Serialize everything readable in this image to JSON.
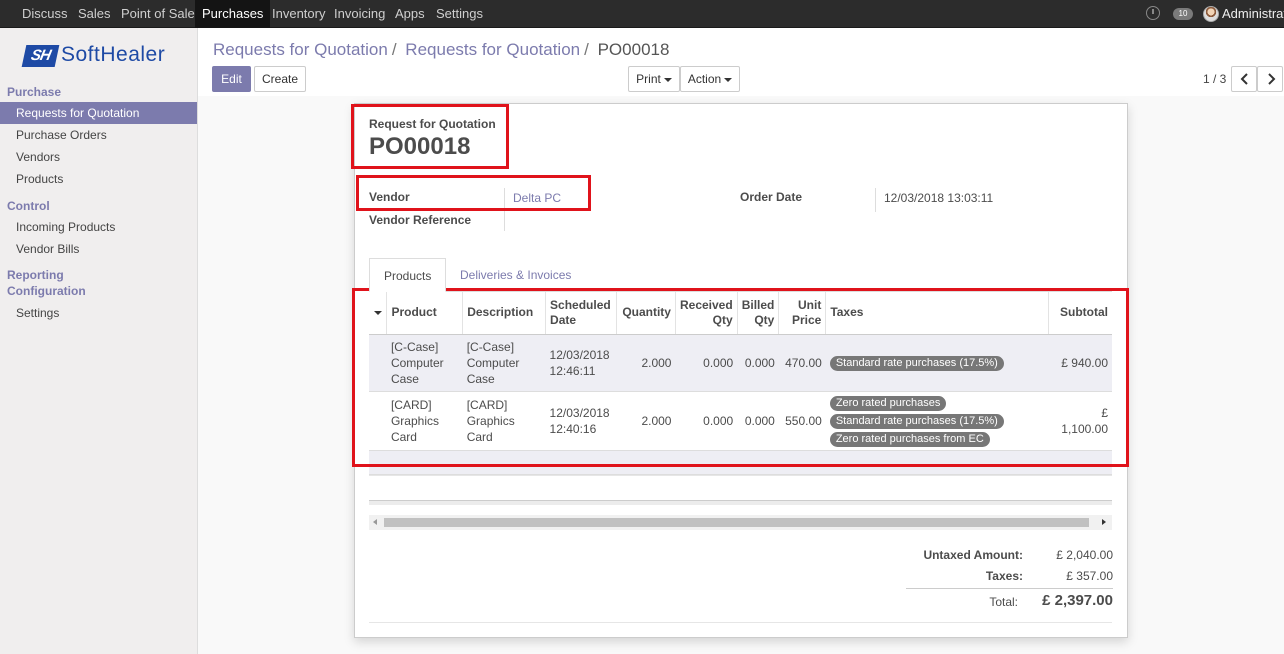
{
  "topbar": {
    "menu": [
      "Discuss",
      "Sales",
      "Point of Sale",
      "Purchases",
      "Inventory",
      "Invoicing",
      "Apps",
      "Settings"
    ],
    "active_menu": "Purchases",
    "chat_count": "10",
    "user": "Administrato"
  },
  "logo": {
    "mark": "SH",
    "text": "SoftHealer"
  },
  "sidebar": {
    "purchase_section": "Purchase",
    "purchase_items": [
      "Requests for Quotation",
      "Purchase Orders",
      "Vendors",
      "Products"
    ],
    "control_section": "Control",
    "control_items": [
      "Incoming Products",
      "Vendor Bills"
    ],
    "reporting_section": "Reporting",
    "configuration_section": "Configuration",
    "configuration_items": [
      "Settings"
    ]
  },
  "breadcrumb": [
    "Requests for Quotation",
    "Requests for Quotation",
    "PO00018"
  ],
  "buttons": {
    "edit": "Edit",
    "create": "Create",
    "print": "Print",
    "action": "Action"
  },
  "pager": "1 / 3",
  "form": {
    "doc_type": "Request for Quotation",
    "doc_number": "PO00018",
    "vendor_label": "Vendor",
    "vendor_value": "Delta PC",
    "vendor_ref_label": "Vendor Reference",
    "vendor_ref_value": "",
    "order_date_label": "Order Date",
    "order_date_value": "12/03/2018 13:03:11"
  },
  "tabs": [
    "Products",
    "Deliveries & Invoices"
  ],
  "lines": {
    "headers": [
      "Product",
      "Description",
      "Scheduled Date",
      "Quantity",
      "Received Qty",
      "Billed Qty",
      "Unit Price",
      "Taxes",
      "Subtotal"
    ],
    "rows": [
      {
        "product": "[C-Case] Computer Case",
        "description": "[C-Case] Computer Case",
        "date": "12/03/2018 12:46:11",
        "quantity": "2.000",
        "received": "0.000",
        "billed": "0.000",
        "price": "470.00",
        "taxes": [
          "Standard rate purchases (17.5%)"
        ],
        "subtotal": "£ 940.00"
      },
      {
        "product": "[CARD] Graphics Card",
        "description": "[CARD] Graphics Card",
        "date": "12/03/2018 12:40:16",
        "quantity": "2.000",
        "received": "0.000",
        "billed": "0.000",
        "price": "550.00",
        "taxes": [
          "Zero rated purchases",
          "Standard rate purchases (17.5%)",
          "Zero rated purchases from EC"
        ],
        "subtotal": "£ 1,100.00"
      }
    ]
  },
  "totals": {
    "untaxed_label": "Untaxed Amount:",
    "untaxed_value": "£ 2,040.00",
    "taxes_label": "Taxes:",
    "taxes_value": "£ 357.00",
    "total_label": "Total:",
    "total_value": "£ 2,397.00"
  },
  "colors": {
    "brand": "#7c7bad",
    "highlight": "#e0131b",
    "logo": "#1e4aa5"
  }
}
